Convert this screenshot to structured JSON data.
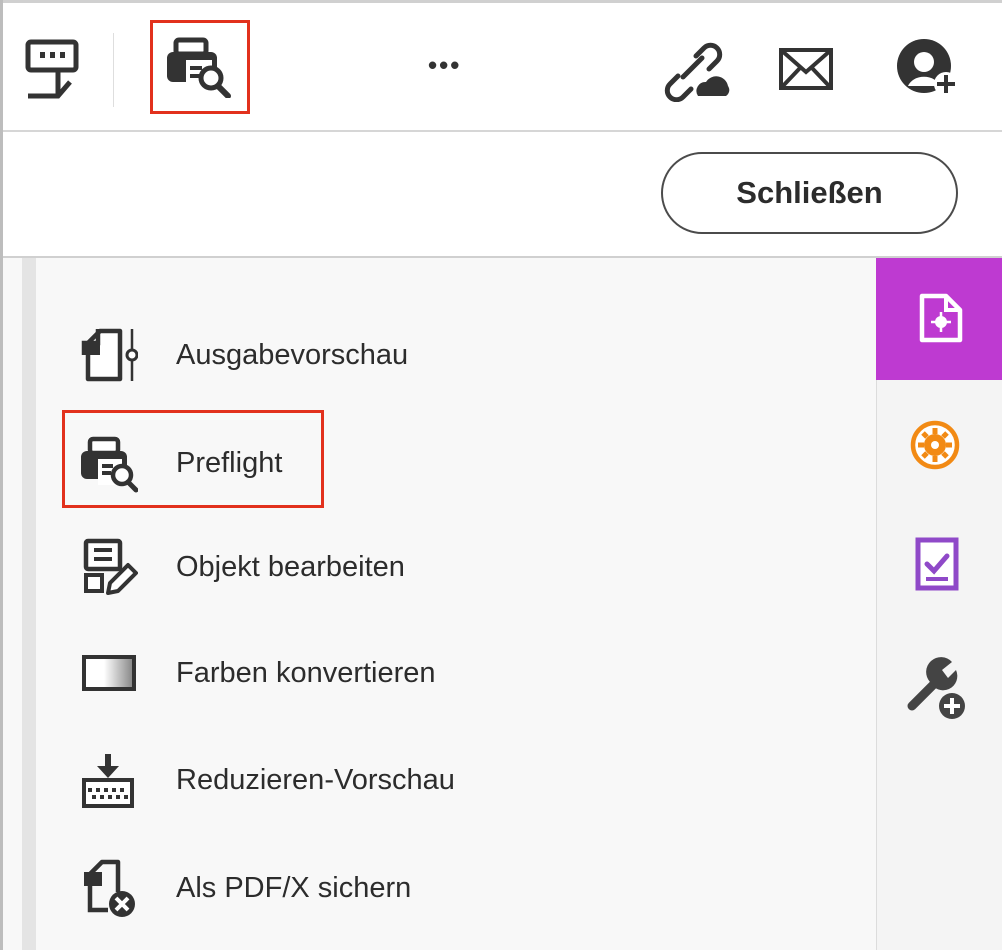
{
  "toolbar": {
    "icons": [
      "form-tools-icon",
      "print-production-icon",
      "more-icon",
      "share-link-icon",
      "email-icon",
      "add-user-icon"
    ],
    "more_label": "•••"
  },
  "close_bar": {
    "close_label": "Schließen"
  },
  "tools": [
    {
      "id": "output-preview",
      "label": "Ausgabevorschau",
      "icon": "output-preview-icon"
    },
    {
      "id": "preflight",
      "label": "Preflight",
      "icon": "preflight-icon",
      "highlighted": true
    },
    {
      "id": "edit-object",
      "label": "Objekt bearbeiten",
      "icon": "edit-object-icon"
    },
    {
      "id": "convert-colors",
      "label": "Farben konvertieren",
      "icon": "convert-colors-icon"
    },
    {
      "id": "flattener-preview",
      "label": "Reduzieren-Vorschau",
      "icon": "flattener-preview-icon"
    },
    {
      "id": "save-as-pdfx",
      "label": "Als PDF/X sichern",
      "icon": "save-pdfx-icon"
    }
  ],
  "rail": {
    "items": [
      "print-production-rail-icon",
      "gear-badge-icon",
      "checklist-icon",
      "wrench-add-icon"
    ],
    "active_color": "#be3ad1"
  },
  "colors": {
    "highlight": "#e2311d",
    "accent": "#be3ad1",
    "orange": "#f28a14",
    "purple": "#8f49c8"
  }
}
